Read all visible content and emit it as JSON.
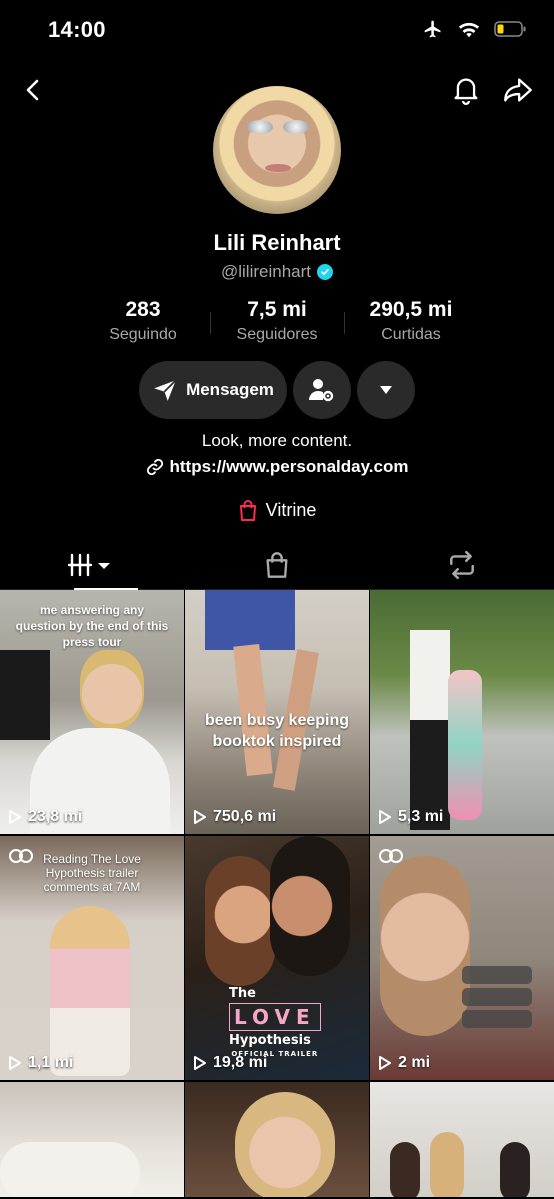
{
  "status_bar": {
    "time": "14:00"
  },
  "profile": {
    "display_name": "Lili Reinhart",
    "handle": "@lilireinhart",
    "bio": "Look, more content.",
    "link": "https://www.personalday.com",
    "shop_label": "Vitrine"
  },
  "stats": [
    {
      "value": "283",
      "label": "Seguindo"
    },
    {
      "value": "7,5 mi",
      "label": "Seguidores"
    },
    {
      "value": "290,5 mi",
      "label": "Curtidas"
    }
  ],
  "actions": {
    "message_label": "Mensagem"
  },
  "colors": {
    "accent": "#fe2c55",
    "verified": "#20d5ec",
    "button_bg": "#2a2a2a",
    "muted": "#a8a8a8"
  },
  "icons": [
    "back-icon",
    "bell-icon",
    "share-icon",
    "send-icon",
    "user-settings-icon",
    "chevron-down-icon",
    "link-icon",
    "shopping-bag-icon",
    "grid-icon",
    "repost-icon",
    "play-icon",
    "carousel-icon"
  ],
  "videos": [
    {
      "caption": "me answering any question by the end of this press tour",
      "views": "23,8 mi"
    },
    {
      "caption": "been busy keeping booktok inspired",
      "views": "750,6 mi"
    },
    {
      "caption": "",
      "views": "5,3 mi"
    },
    {
      "caption": "Reading The Love Hypothesis trailer comments at 7AM",
      "views": "1,1 mi"
    },
    {
      "caption": "",
      "views": "19,8 mi",
      "title_overlay": "The",
      "title_main": "LOVE",
      "title_sub": "Hypothesis",
      "title_tag": "OFFICIAL TRAILER"
    },
    {
      "caption": "",
      "views": "2 mi"
    }
  ]
}
